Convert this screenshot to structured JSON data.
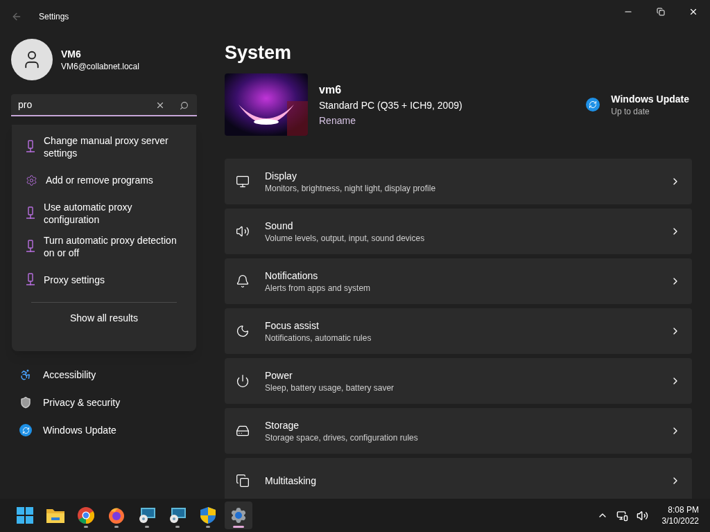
{
  "window": {
    "title": "Settings"
  },
  "account": {
    "name": "VM6",
    "email": "VM6@collabnet.local"
  },
  "search": {
    "value": "pro",
    "results": [
      {
        "kind": "proxy",
        "label": "Change manual proxy server settings"
      },
      {
        "kind": "gear",
        "label": "Add or remove programs"
      },
      {
        "kind": "proxy",
        "label": "Use automatic proxy configuration"
      },
      {
        "kind": "proxy",
        "label": "Turn automatic proxy detection on or off"
      },
      {
        "kind": "proxy",
        "label": "Proxy settings"
      }
    ],
    "show_all": "Show all results"
  },
  "sidebar": {
    "items": [
      {
        "kind": "accessibility",
        "label": "Accessibility",
        "selected": false
      },
      {
        "kind": "shield",
        "label": "Privacy & security",
        "selected": false
      },
      {
        "kind": "update",
        "label": "Windows Update",
        "selected": false
      }
    ]
  },
  "page": {
    "title": "System",
    "device": {
      "name": "vm6",
      "model": "Standard PC (Q35 + ICH9, 2009)",
      "rename": "Rename"
    },
    "update": {
      "title": "Windows Update",
      "status": "Up to date"
    },
    "cards": [
      {
        "kind": "display",
        "title": "Display",
        "subtitle": "Monitors, brightness, night light, display profile"
      },
      {
        "kind": "sound",
        "title": "Sound",
        "subtitle": "Volume levels, output, input, sound devices"
      },
      {
        "kind": "notifications",
        "title": "Notifications",
        "subtitle": "Alerts from apps and system"
      },
      {
        "kind": "focus",
        "title": "Focus assist",
        "subtitle": "Notifications, automatic rules"
      },
      {
        "kind": "power",
        "title": "Power",
        "subtitle": "Sleep, battery usage, battery saver"
      },
      {
        "kind": "storage",
        "title": "Storage",
        "subtitle": "Storage space, drives, configuration rules"
      },
      {
        "kind": "multitasking",
        "title": "Multitasking"
      }
    ]
  },
  "taskbar": {
    "apps": [
      {
        "kind": "start",
        "running": false,
        "active": false
      },
      {
        "kind": "folder",
        "running": false,
        "active": false
      },
      {
        "kind": "chrome",
        "running": true,
        "active": false
      },
      {
        "kind": "firefox",
        "running": true,
        "active": false
      },
      {
        "kind": "remote",
        "running": true,
        "active": false
      },
      {
        "kind": "remote",
        "running": true,
        "active": false
      },
      {
        "kind": "shield",
        "running": true,
        "active": false
      },
      {
        "kind": "settings",
        "running": true,
        "active": true
      }
    ],
    "time": "8:08 PM",
    "date": "3/10/2022"
  }
}
